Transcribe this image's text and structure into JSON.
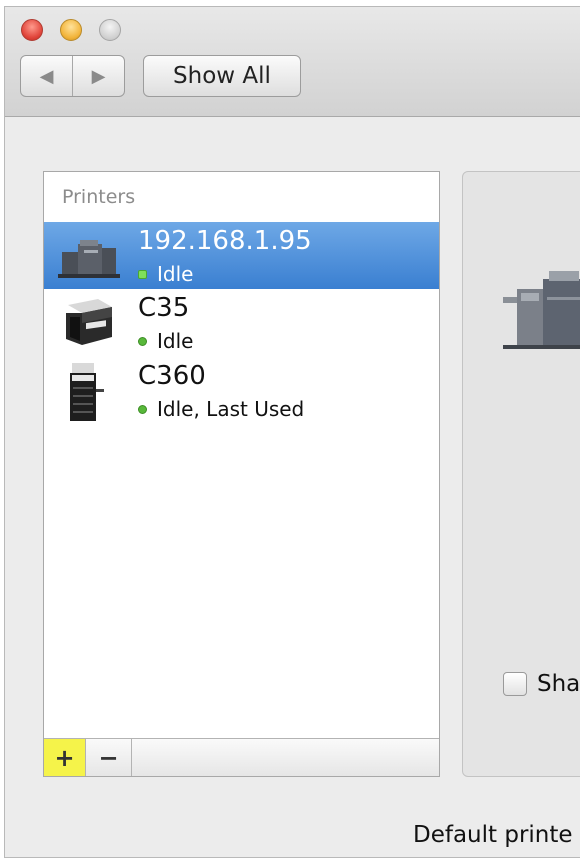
{
  "toolbar": {
    "back_glyph": "◀",
    "forward_glyph": "▶",
    "show_all_label": "Show All"
  },
  "printers": {
    "header": "Printers",
    "items": [
      {
        "name": "192.168.1.95",
        "status": "Idle",
        "selected": true,
        "icon": "production-printer-icon"
      },
      {
        "name": "C35",
        "status": "Idle",
        "selected": false,
        "icon": "multifunction-printer-icon"
      },
      {
        "name": "C360",
        "status": "Idle, Last Used",
        "selected": false,
        "icon": "tower-printer-icon"
      }
    ],
    "add_label": "+",
    "remove_label": "−"
  },
  "detail": {
    "share_label": "Sha"
  },
  "footer": {
    "default_printer_label": "Default printe"
  },
  "colors": {
    "selection": "#3a7fd1",
    "status_green": "#58b83a",
    "add_highlight": "#f5f34a"
  }
}
